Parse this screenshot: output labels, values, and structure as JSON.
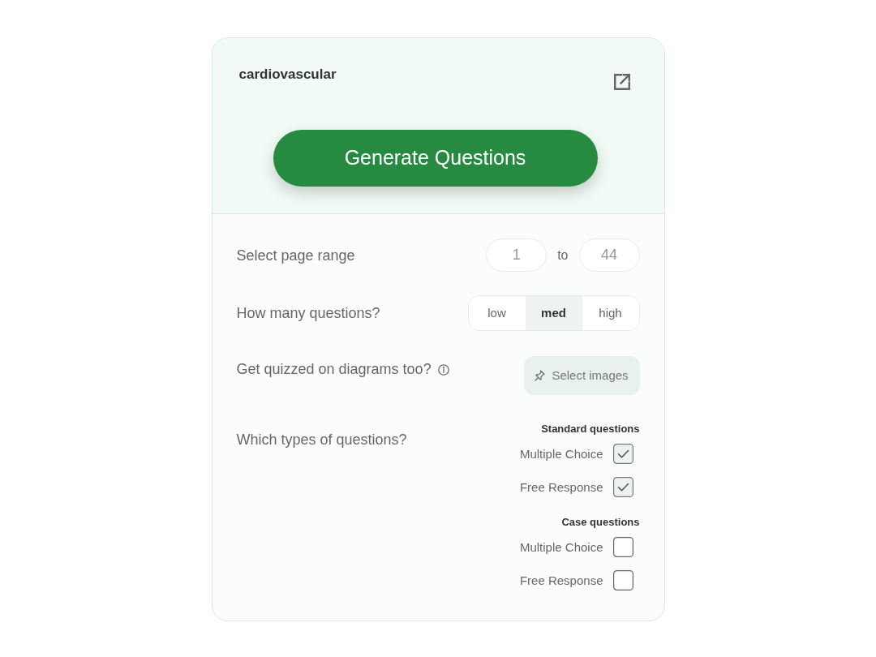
{
  "card": {
    "title": "cardiovascular",
    "generate_button": "Generate Questions"
  },
  "page_range": {
    "label": "Select page range",
    "from": "1",
    "separator": "to",
    "to": "44"
  },
  "question_count": {
    "label": "How many questions?",
    "options": [
      {
        "label": "low",
        "selected": false
      },
      {
        "label": "med",
        "selected": true
      },
      {
        "label": "high",
        "selected": false
      }
    ]
  },
  "diagrams": {
    "label": "Get quizzed on diagrams too?",
    "button": "Select images"
  },
  "question_types": {
    "label": "Which types of questions?",
    "groups": [
      {
        "heading": "Standard questions",
        "options": [
          {
            "label": "Multiple Choice",
            "checked": true
          },
          {
            "label": "Free Response",
            "checked": true
          }
        ]
      },
      {
        "heading": "Case questions",
        "options": [
          {
            "label": "Multiple Choice",
            "checked": false
          },
          {
            "label": "Free Response",
            "checked": false
          }
        ]
      }
    ]
  }
}
